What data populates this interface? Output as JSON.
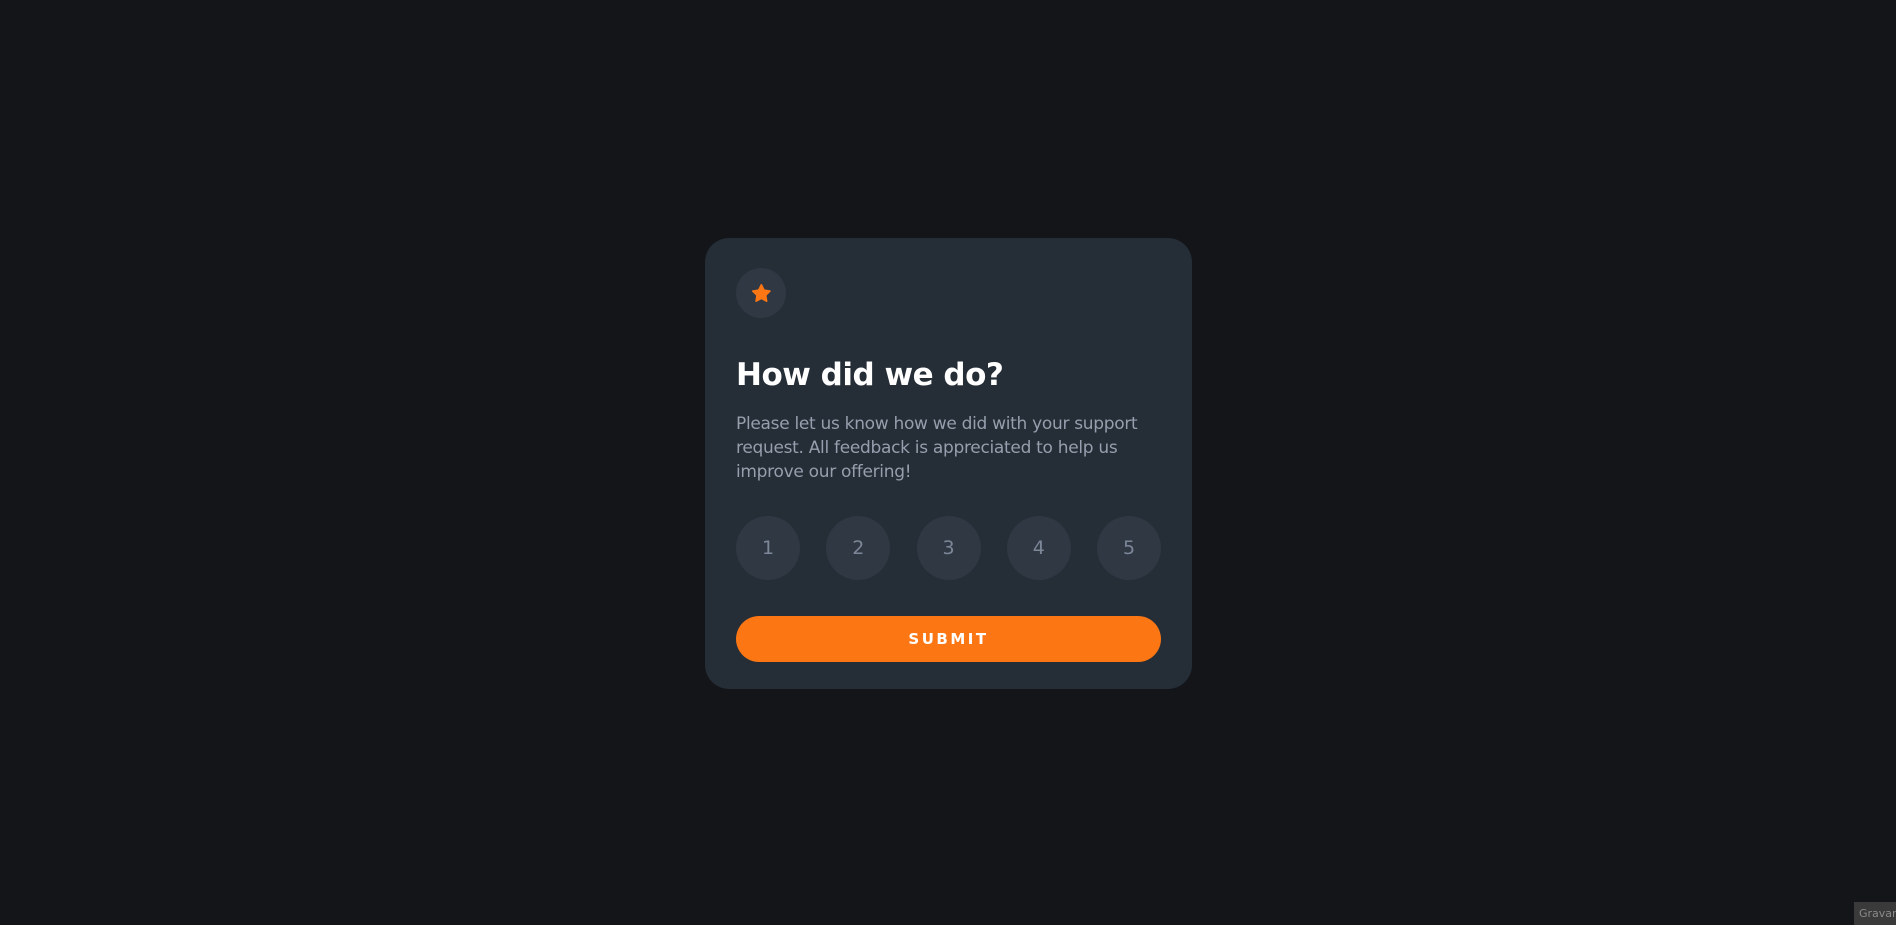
{
  "card": {
    "icon": "star-icon",
    "title": "How did we do?",
    "description": "Please let us know how we did with your support request. All feedback is appreciated to help us improve our offering!",
    "ratings": [
      "1",
      "2",
      "3",
      "4",
      "5"
    ],
    "submit_label": "SUBMIT"
  },
  "attribution": {
    "text": "Gravar"
  },
  "colors": {
    "background": "#131518",
    "card": "#252d37",
    "badge": "#2f3843",
    "accent": "#fc7614",
    "text_muted": "#969fad",
    "rating_text": "#7c8798"
  }
}
